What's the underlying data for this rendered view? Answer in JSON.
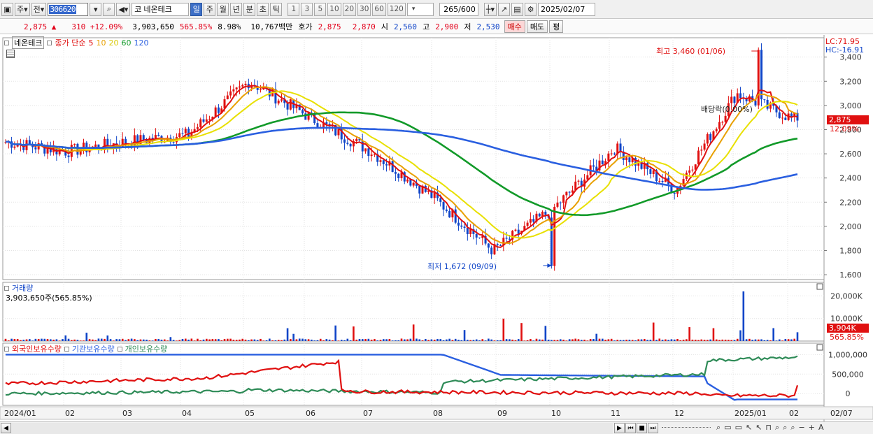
{
  "toolbar": {
    "period_label": "주",
    "prev_label": "전",
    "stock_code": "306620",
    "stock_name": "네온테크",
    "stock_prefix": "코",
    "period_tabs": [
      "일",
      "주",
      "월",
      "년",
      "분",
      "초",
      "틱"
    ],
    "selected_period": "일",
    "intervals": [
      "1",
      "3",
      "5",
      "10",
      "20",
      "30",
      "60",
      "120"
    ],
    "range_value": "265",
    "range_total": "/600",
    "date_value": "2025/02/07"
  },
  "quote": {
    "price": "2,875",
    "change_arrow": "▲",
    "change": "310",
    "change_pct": "+12.09%",
    "volume": "3,903,650",
    "volume_pct": "565.85%",
    "turnover_pct": "8.98%",
    "amount": "10,767백만",
    "ask_label": "호가",
    "ask": "2,875",
    "bid": "2,870",
    "open_label": "시",
    "open": "2,560",
    "high_label": "고",
    "high": "2,900",
    "low_label": "저",
    "low": "2,530",
    "buy_label": "매수",
    "sell_label": "매도",
    "eval_label": "평"
  },
  "price_panel": {
    "legend_name": "네온테크",
    "legend_ma": "종가 단순",
    "ma_periods": [
      "5",
      "10",
      "20",
      "60",
      "120"
    ],
    "ma_colors": [
      "#e01010",
      "#e8a000",
      "#e8e000",
      "#129a29",
      "#2a5fe0"
    ],
    "lc_label": "LC:71.95",
    "hc_label": "HC:-16.91",
    "high_annotation": "최고 3,460 (01/06)",
    "low_annotation": "최저 1,672 (09/09)",
    "dividend_annotation": "배당락(0.00%)",
    "last_price_tag": "2,875",
    "last_pct_tag": "12.09%",
    "y_ticks": [
      "3,400",
      "3,200",
      "3,000",
      "2,800",
      "2,600",
      "2,400",
      "2,200",
      "2,000",
      "1,800",
      "1,600"
    ]
  },
  "volume_panel": {
    "title": "거래량",
    "value_label": "3,903,650주(565.85%)",
    "y_ticks": [
      "20,000K",
      "10,000K"
    ],
    "last_tag": "3,904K",
    "last_pct_tag": "565.85%"
  },
  "holdings_panel": {
    "legend": [
      "외국인보유수량",
      "기관보유수량",
      "개인보유수량"
    ],
    "legend_colors": [
      "#e01010",
      "#2a5fe0",
      "#2e8b57"
    ],
    "y_ticks": [
      "1,000,000",
      "500,000",
      "0"
    ]
  },
  "x_axis": [
    "2024/01",
    "02",
    "03",
    "04",
    "05",
    "06",
    "07",
    "08",
    "09",
    "10",
    "11",
    "12",
    "2025/01",
    "02",
    "02/07"
  ],
  "chart_data": {
    "type": "line",
    "xlabel": "",
    "ylabel": "",
    "ylim": [
      1600,
      3460
    ],
    "series": [
      {
        "name": "종가",
        "months": [
          "2024/01",
          "02",
          "03",
          "04",
          "05",
          "06",
          "07",
          "08",
          "09",
          "10",
          "11",
          "12",
          "2025/01",
          "02"
        ],
        "values": [
          2700,
          2620,
          2700,
          2760,
          3200,
          2900,
          2620,
          2250,
          1800,
          2150,
          2650,
          2300,
          3100,
          2875
        ]
      }
    ],
    "high": {
      "value": 3460,
      "date": "01/06"
    },
    "low": {
      "value": 1672,
      "date": "09/09"
    }
  }
}
